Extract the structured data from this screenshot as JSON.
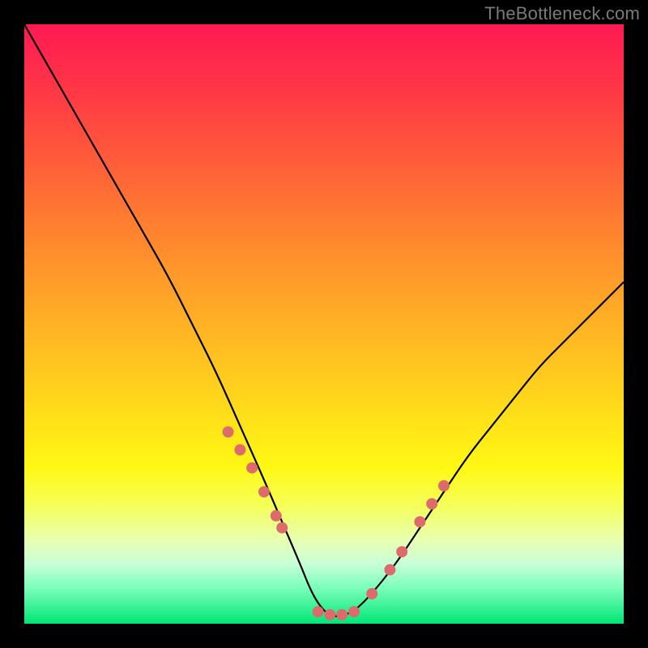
{
  "watermark": "TheBottleneck.com",
  "chart_data": {
    "type": "line",
    "title": "",
    "xlabel": "",
    "ylabel": "",
    "xlim": [
      0,
      100
    ],
    "ylim": [
      0,
      100
    ],
    "series": [
      {
        "name": "bottleneck-curve",
        "x": [
          0,
          4,
          8,
          12,
          16,
          20,
          24,
          28,
          32,
          36,
          40,
          43,
          46,
          48,
          50,
          52,
          55,
          58,
          62,
          66,
          70,
          74,
          78,
          82,
          86,
          90,
          94,
          98,
          100
        ],
        "values": [
          100,
          93,
          86,
          79,
          72,
          65,
          58,
          50,
          42,
          33,
          24,
          17,
          10,
          5,
          2,
          1,
          2,
          5,
          10,
          16,
          22,
          28,
          33,
          38,
          43,
          47,
          51,
          55,
          57
        ]
      }
    ],
    "markers": {
      "name": "highlight-points",
      "color": "#dd6b6b",
      "x": [
        34,
        36,
        38,
        40,
        42,
        43,
        49,
        51,
        53,
        55,
        58,
        61,
        63,
        66,
        68,
        70
      ],
      "values": [
        32,
        29,
        26,
        22,
        18,
        16,
        2,
        1.5,
        1.5,
        2,
        5,
        9,
        12,
        17,
        20,
        23
      ]
    },
    "gradient_stops": [
      {
        "pos": 0.0,
        "color": "#ff1a52"
      },
      {
        "pos": 0.3,
        "color": "#ff7433"
      },
      {
        "pos": 0.55,
        "color": "#ffc021"
      },
      {
        "pos": 0.74,
        "color": "#fff814"
      },
      {
        "pos": 0.9,
        "color": "#c8ffd8"
      },
      {
        "pos": 1.0,
        "color": "#00e676"
      }
    ]
  }
}
